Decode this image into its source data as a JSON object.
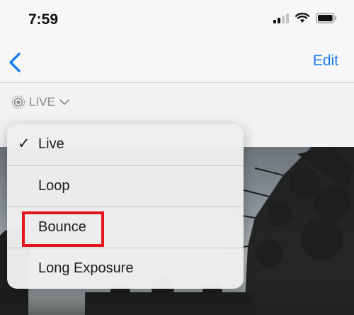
{
  "status_bar": {
    "time": "7:59",
    "icons": [
      "signal-icon",
      "wifi-icon",
      "battery-icon"
    ]
  },
  "nav": {
    "back_icon": "chevron-left-icon",
    "edit_label": "Edit",
    "accent_color": "#1a7cf1"
  },
  "live_toggle": {
    "icon": "live-photo-icon",
    "label": "LIVE",
    "chevron": "chevron-down-icon"
  },
  "menu": {
    "selected": "Live",
    "items": [
      {
        "label": "Live",
        "checked": true
      },
      {
        "label": "Loop",
        "checked": false
      },
      {
        "label": "Bounce",
        "checked": false
      },
      {
        "label": "Long Exposure",
        "checked": false
      }
    ],
    "highlight_color": "#e6151d"
  }
}
